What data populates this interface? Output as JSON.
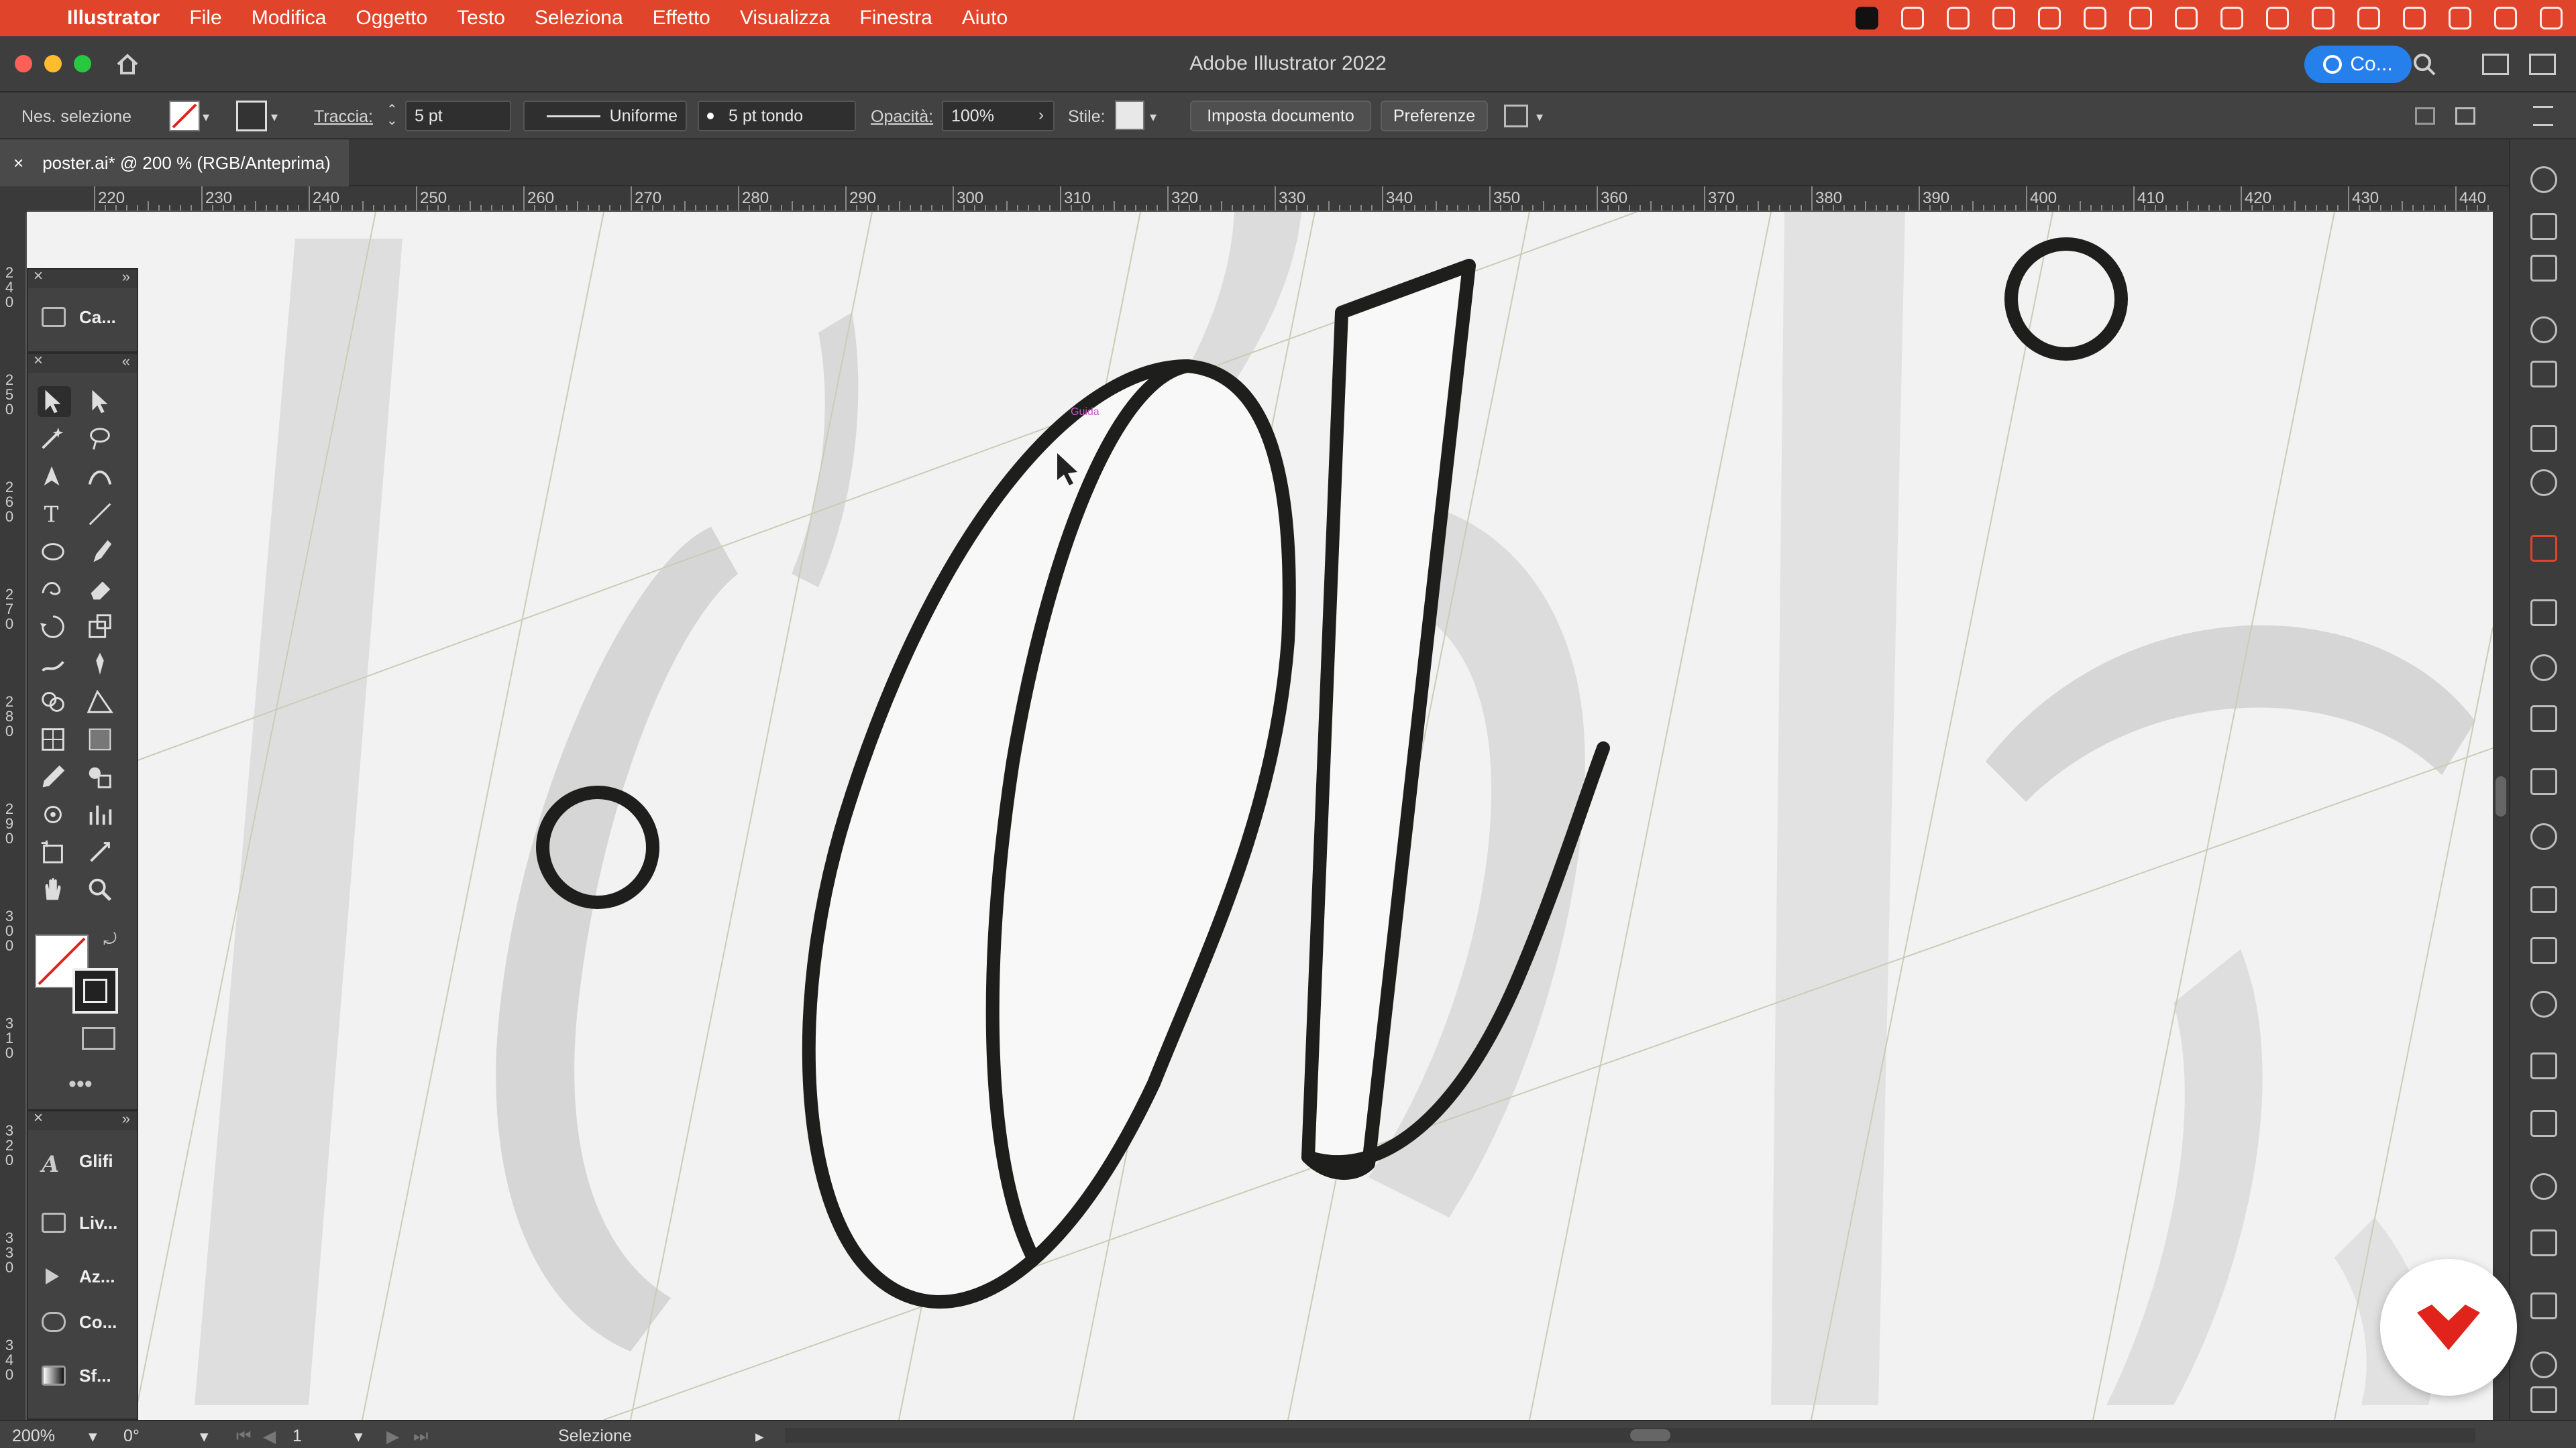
{
  "menubar": {
    "app_name": "Illustrator",
    "items": [
      "File",
      "Modifica",
      "Oggetto",
      "Testo",
      "Seleziona",
      "Effetto",
      "Visualizza",
      "Finestra",
      "Aiuto"
    ]
  },
  "window": {
    "title": "Adobe Illustrator 2022",
    "share_label": "Co..."
  },
  "controlbar": {
    "selection": "Nes. selezione",
    "stroke_label": "Traccia:",
    "stroke_weight": "5 pt",
    "profile": "Uniforme",
    "brush": "5 pt tondo",
    "opacity_label": "Opacità:",
    "opacity_value": "100%",
    "style_label": "Stile:",
    "doc_setup": "Imposta documento",
    "preferences": "Preferenze"
  },
  "tab": {
    "label": "poster.ai* @ 200 % (RGB/Anteprima)"
  },
  "ruler": {
    "h_ticks": [
      "220",
      "230",
      "240",
      "250",
      "260",
      "270",
      "280",
      "290",
      "300",
      "310",
      "320",
      "330",
      "340",
      "350",
      "360",
      "370",
      "380",
      "390",
      "400",
      "410",
      "420",
      "430",
      "440"
    ],
    "v_ticks": [
      "240",
      "250",
      "260",
      "270",
      "280",
      "290",
      "300",
      "310",
      "320",
      "330",
      "340"
    ]
  },
  "panels": {
    "top": [
      "Ca..."
    ],
    "bottom": [
      "Glifi",
      "Liv...",
      "Az...",
      "Co...",
      "Sf..."
    ]
  },
  "statusbar": {
    "zoom": "200%",
    "rotation": "0°",
    "artboard": "1",
    "tool": "Selezione"
  },
  "canvas": {
    "hint_label": "Guida"
  },
  "colors": {
    "menubar": "#e0442a",
    "accent": "#2680eb",
    "stroke": "#1e1e1c",
    "guide": "#c9cdb6",
    "badge": "#e0241b"
  }
}
